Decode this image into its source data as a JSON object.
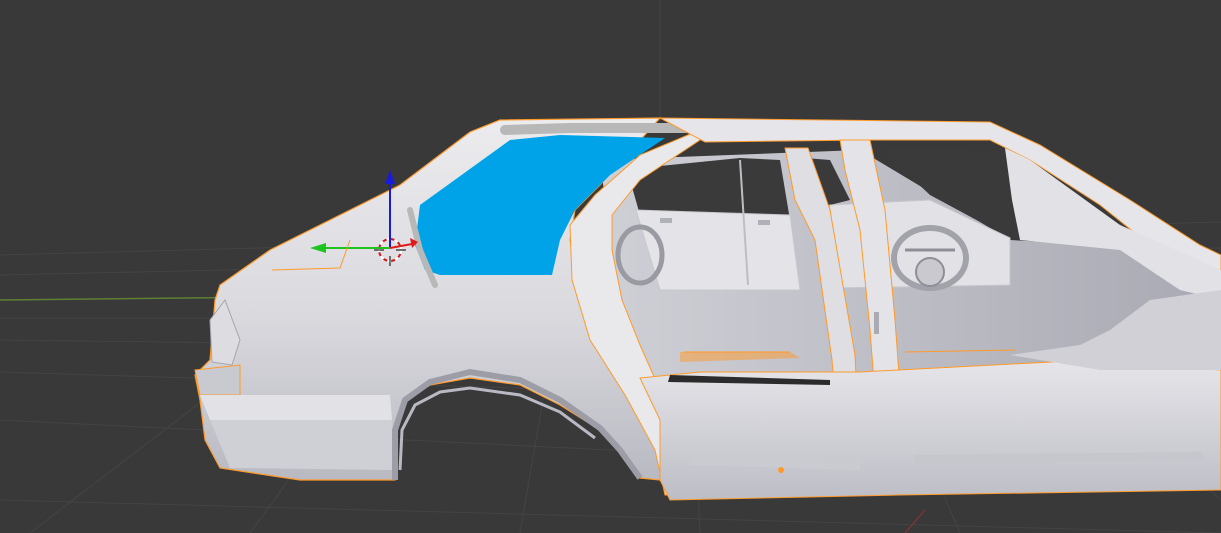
{
  "viewport": {
    "background": "#393939",
    "grid_color": "#444444",
    "x_axis_color": "#6a8a3a",
    "y_axis_color": "#8a3a3a",
    "selection_outline_color": "#ff9a2a",
    "glass_paint_color": "#00a3e8",
    "body_color": "#d8d8dc"
  },
  "gizmo": {
    "z_axis_color": "#1a1adc",
    "y_axis_color": "#1ec31e",
    "x_axis_color": "#e01a1a"
  },
  "object": {
    "name_icon": "car-body-mesh-icon",
    "cursor_icon": "3d-cursor-icon",
    "gizmo_icon": "transform-gizmo-icon"
  }
}
